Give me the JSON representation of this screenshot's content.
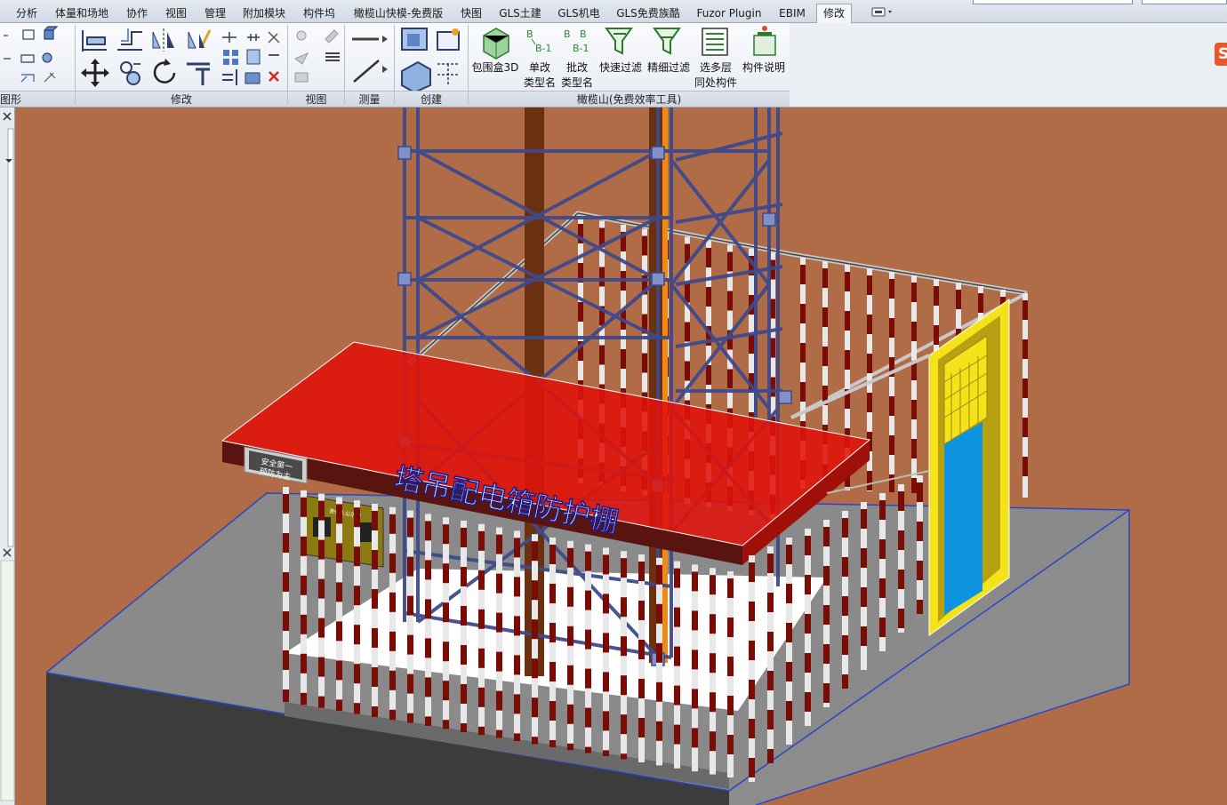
{
  "tabs": [
    {
      "label": "分析",
      "active": false
    },
    {
      "label": "体量和场地",
      "active": false
    },
    {
      "label": "协作",
      "active": false
    },
    {
      "label": "视图",
      "active": false
    },
    {
      "label": "管理",
      "active": false
    },
    {
      "label": "附加模块",
      "active": false
    },
    {
      "label": "构件坞",
      "active": false
    },
    {
      "label": "橄榄山快模-免费版",
      "active": false
    },
    {
      "label": "快图",
      "active": false
    },
    {
      "label": "GLS土建",
      "active": false
    },
    {
      "label": "GLS机电",
      "active": false
    },
    {
      "label": "GLS免费族酷",
      "active": false
    },
    {
      "label": "Fuzor Plugin",
      "active": false
    },
    {
      "label": "EBIM",
      "active": false
    },
    {
      "label": "修改",
      "active": true
    }
  ],
  "ribbon": {
    "panels": {
      "geometry": "图形",
      "modify": "修改",
      "view": "视图",
      "measure": "测量",
      "create": "创建",
      "gls_tools": "橄榄山(免费效率工具)"
    },
    "tools": [
      {
        "line1": "包围盒3D",
        "line2": ""
      },
      {
        "line1": "单改",
        "line2": "类型名"
      },
      {
        "line1": "批改",
        "line2": "类型名"
      },
      {
        "line1": "快速过滤",
        "line2": ""
      },
      {
        "line1": "精细过滤",
        "line2": ""
      },
      {
        "line1": "选多层",
        "line2": "同处构件"
      },
      {
        "line1": "构件说明",
        "line2": ""
      }
    ]
  },
  "model": {
    "canopy_title": "塔吊配电箱防护棚",
    "logo_lines": [
      "安全第一",
      "预防为主"
    ],
    "notice_board_title": "责任人公示牌"
  },
  "colors": {
    "background": "#b06c47",
    "roof_red": "#e0120a",
    "fascia": "#5a1410",
    "tower": "#3f4a8a",
    "door_frame": "#f5e31a",
    "door_panel": "#0d93e0",
    "slab_top": "#8a8a8a",
    "slab_side": "#3c3c3c"
  }
}
